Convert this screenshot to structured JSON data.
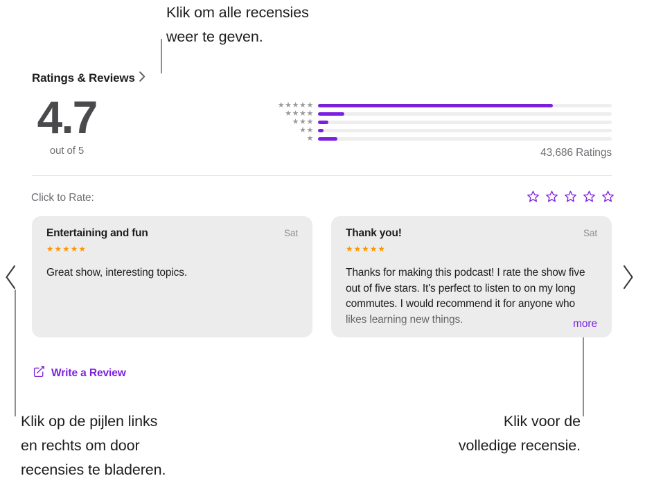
{
  "callouts": {
    "top": "Klik om alle recensies\nweer te geven.",
    "bottom_left": "Klik op de pijlen links\nen rechts om door\nrecensies te bladeren.",
    "bottom_right": "Klik voor de\nvolledige recensie."
  },
  "section": {
    "title": "Ratings & Reviews",
    "chevron_icon": "chevron-right-icon"
  },
  "score": {
    "value": "4.7",
    "out_of": "out of 5"
  },
  "chart_data": {
    "type": "bar",
    "title": "Ratings & Reviews",
    "orientation": "horizontal",
    "categories": [
      "5 stars",
      "4 stars",
      "3 stars",
      "2 stars",
      "1 star"
    ],
    "tick_labels": [
      "★★★★★",
      "★★★★",
      "★★★",
      "★★",
      "★"
    ],
    "values": [
      80,
      9,
      3.5,
      2,
      6.5
    ],
    "xlabel": "",
    "ylabel": "",
    "xlim": [
      0,
      100
    ],
    "grid": false,
    "legend": "none",
    "bar_color": "#7B21DE",
    "track_color": "#EEEEEE",
    "total_label": "43,686 Ratings",
    "average": 4.7,
    "scale_max": 5
  },
  "rate": {
    "label": "Click to Rate:",
    "star_icon": "star-outline-icon",
    "star_count": 5,
    "selected": 0,
    "color": "#8021DD"
  },
  "reviews": [
    {
      "title": "Entertaining and fun",
      "date": "Sat",
      "stars": "★★★★★",
      "rating": 5,
      "body": "Great show, interesting topics.",
      "truncated": false,
      "more_label": ""
    },
    {
      "title": "Thank you!",
      "date": "Sat",
      "stars": "★★★★★",
      "rating": 5,
      "body": "Thanks for making this podcast! I rate the show five out of five stars. It's perfect to listen to on my long commutes. I would recommend it for anyone who likes learning new things.",
      "truncated": true,
      "more_label": "more"
    }
  ],
  "nav": {
    "prev_icon": "chevron-left-icon",
    "next_icon": "chevron-right-icon"
  },
  "write_review": {
    "label": "Write a Review",
    "icon": "compose-pencil-icon"
  },
  "colors": {
    "accent_purple": "#7B21DE",
    "star_orange": "#FF9500",
    "card_background": "#ECECEC",
    "text_primary": "#1D1D1F",
    "text_secondary": "#6E6E73"
  }
}
